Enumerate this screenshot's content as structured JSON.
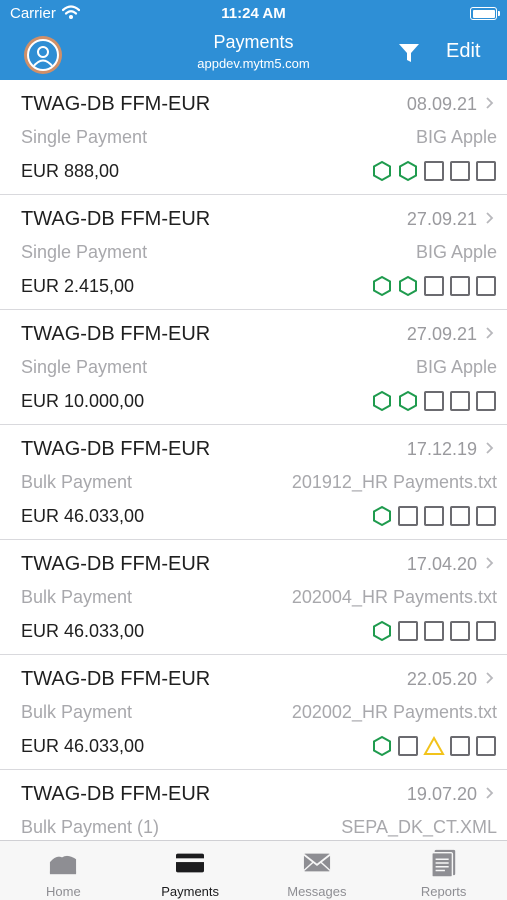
{
  "status": {
    "carrier": "Carrier",
    "time": "11:24 AM"
  },
  "header": {
    "title": "Payments",
    "subtitle": "appdev.mytm5.com",
    "edit_label": "Edit"
  },
  "colors": {
    "accent": "#2e8fd6",
    "status_ok": "#1f9b4e",
    "status_warning": "#f2c31b",
    "status_empty": "#6b6b70"
  },
  "payments": [
    {
      "account": "TWAG-DB FFM-EUR",
      "date": "08.09.21",
      "type": "Single Payment",
      "reference": "BIG Apple",
      "amount": "EUR 888,00",
      "status_icons": [
        "hexagon-ok",
        "hexagon-ok",
        "square",
        "square",
        "square"
      ]
    },
    {
      "account": "TWAG-DB FFM-EUR",
      "date": "27.09.21",
      "type": "Single Payment",
      "reference": "BIG Apple",
      "amount": "EUR 2.415,00",
      "status_icons": [
        "hexagon-ok",
        "hexagon-ok",
        "square",
        "square",
        "square"
      ]
    },
    {
      "account": "TWAG-DB FFM-EUR",
      "date": "27.09.21",
      "type": "Single Payment",
      "reference": "BIG Apple",
      "amount": "EUR 10.000,00",
      "status_icons": [
        "hexagon-ok",
        "hexagon-ok",
        "square",
        "square",
        "square"
      ]
    },
    {
      "account": "TWAG-DB FFM-EUR",
      "date": "17.12.19",
      "type": "Bulk Payment",
      "reference": "201912_HR Payments.txt",
      "amount": "EUR 46.033,00",
      "status_icons": [
        "hexagon-ok",
        "square",
        "square",
        "square",
        "square"
      ]
    },
    {
      "account": "TWAG-DB FFM-EUR",
      "date": "17.04.20",
      "type": "Bulk Payment",
      "reference": "202004_HR Payments.txt",
      "amount": "EUR 46.033,00",
      "status_icons": [
        "hexagon-ok",
        "square",
        "square",
        "square",
        "square"
      ]
    },
    {
      "account": "TWAG-DB FFM-EUR",
      "date": "22.05.20",
      "type": "Bulk Payment",
      "reference": "202002_HR Payments.txt",
      "amount": "EUR 46.033,00",
      "status_icons": [
        "hexagon-ok",
        "square",
        "triangle-warning",
        "square",
        "square"
      ]
    },
    {
      "account": "TWAG-DB FFM-EUR",
      "date": "19.07.20",
      "type": "Bulk Payment (1)",
      "reference": "SEPA_DK_CT.XML",
      "amount": "",
      "status_icons": []
    }
  ],
  "tabs": [
    {
      "label": "Home",
      "icon": "home-icon"
    },
    {
      "label": "Payments",
      "icon": "payments-card-icon"
    },
    {
      "label": "Messages",
      "icon": "envelope-icon"
    },
    {
      "label": "Reports",
      "icon": "reports-document-icon"
    }
  ],
  "active_tab": "Payments"
}
